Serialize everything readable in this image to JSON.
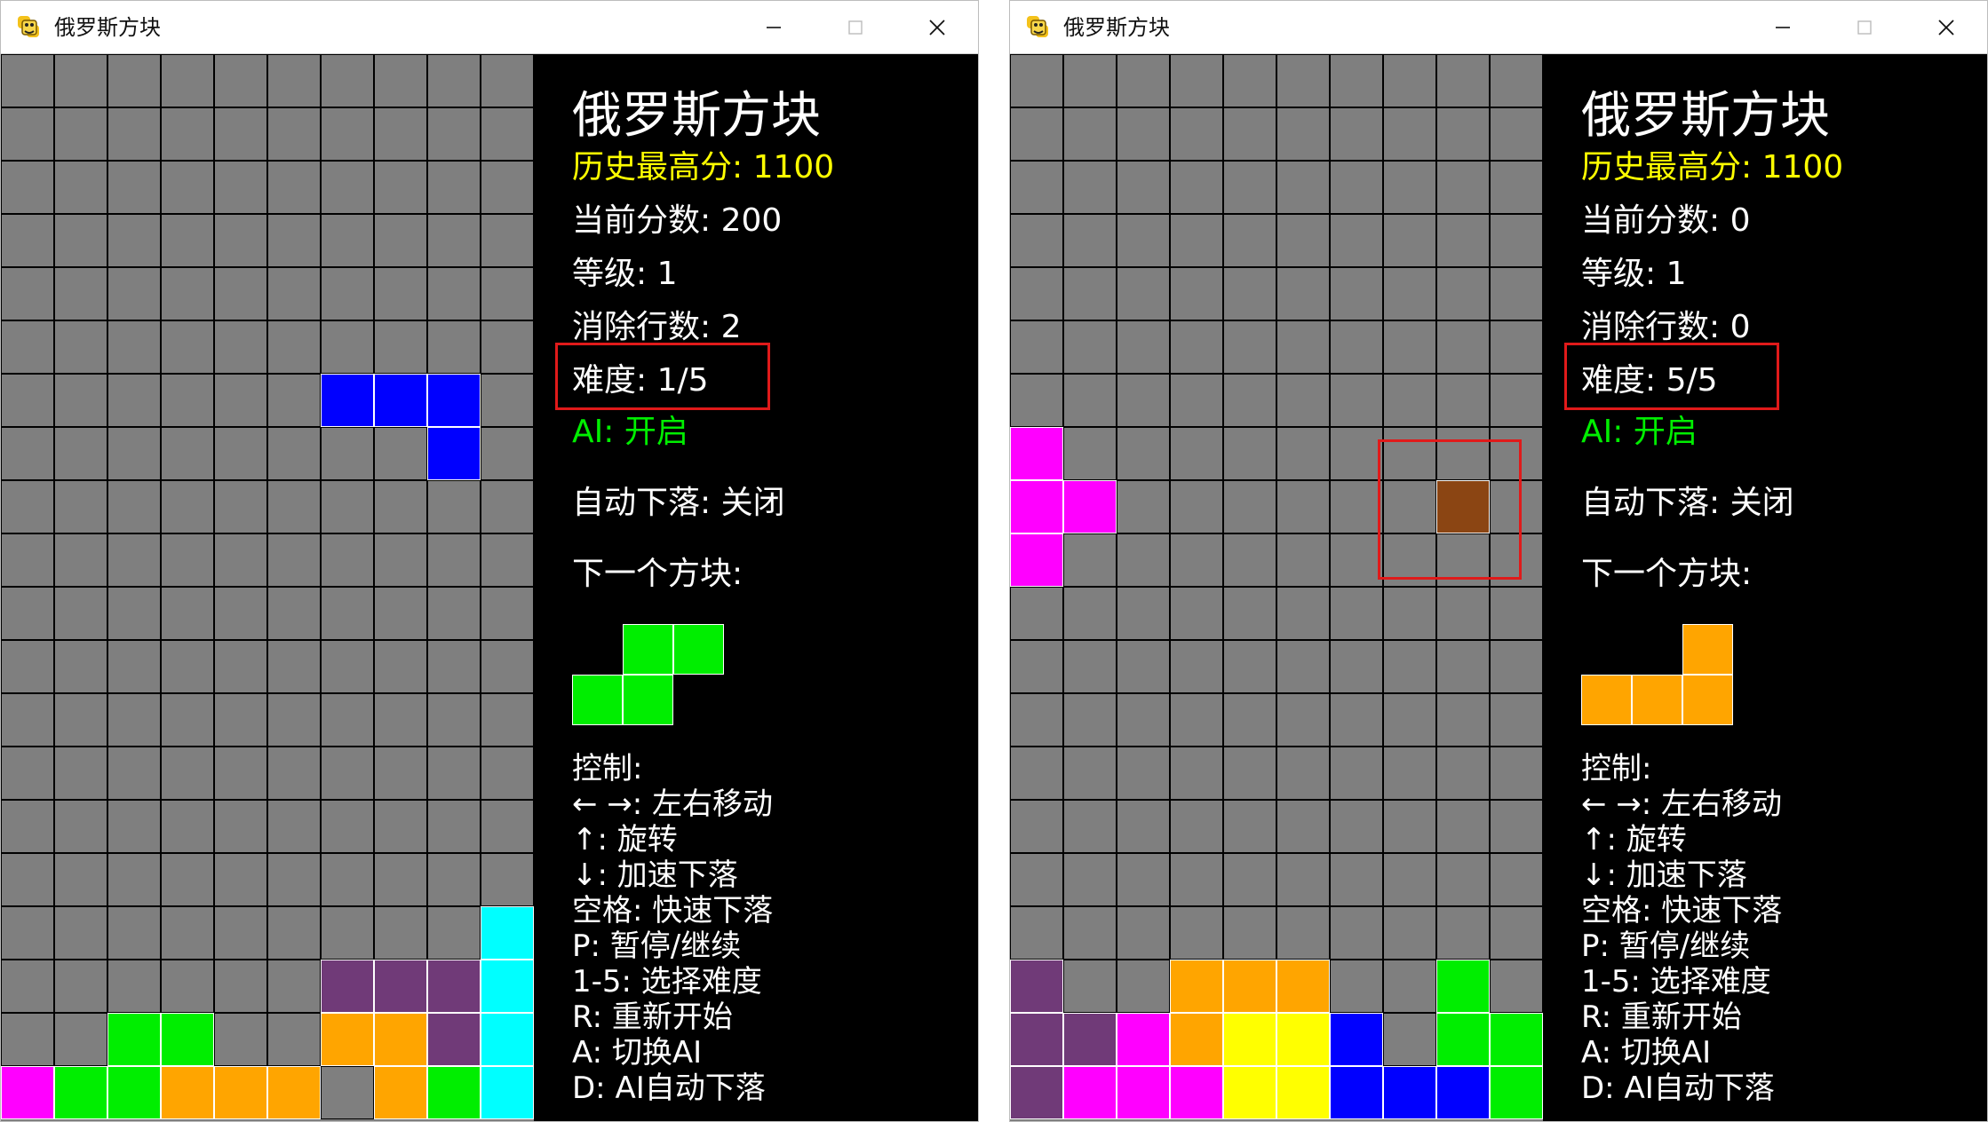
{
  "windows": [
    {
      "title": "俄罗斯方块",
      "panel": {
        "heading": "俄罗斯方块",
        "high_score": "历史最高分: 1100",
        "score": "当前分数: 200",
        "level": "等级: 1",
        "lines": "消除行数: 2",
        "difficulty": "难度: 1/5",
        "ai": "AI: 开启",
        "auto_drop": "自动下落: 关闭",
        "next_label": "下一个方块:",
        "controls": [
          "控制:",
          "← →: 左右移动",
          "↑: 旋转",
          "↓: 加速下落",
          "空格: 快速下落",
          "P: 暂停/继续",
          "1-5: 选择难度",
          "R: 重新开始",
          "A: 切换AI",
          "D: AI自动下落"
        ]
      },
      "next_piece": {
        "color": "#00ee00",
        "cells": [
          [
            1,
            0
          ],
          [
            2,
            0
          ],
          [
            0,
            1
          ],
          [
            1,
            1
          ]
        ]
      },
      "board": {
        "cols": 10,
        "rows": 20,
        "blocks": [
          {
            "col": 6,
            "row": 6,
            "color": "#0000ff"
          },
          {
            "col": 7,
            "row": 6,
            "color": "#0000ff"
          },
          {
            "col": 8,
            "row": 6,
            "color": "#0000ff"
          },
          {
            "col": 8,
            "row": 7,
            "color": "#0000ff"
          },
          {
            "col": 9,
            "row": 16,
            "color": "#00ffff"
          },
          {
            "col": 9,
            "row": 17,
            "color": "#00ffff"
          },
          {
            "col": 9,
            "row": 18,
            "color": "#00ffff"
          },
          {
            "col": 9,
            "row": 19,
            "color": "#00ffff"
          },
          {
            "col": 6,
            "row": 17,
            "color": "#703a78"
          },
          {
            "col": 7,
            "row": 17,
            "color": "#703a78"
          },
          {
            "col": 8,
            "row": 17,
            "color": "#703a78"
          },
          {
            "col": 8,
            "row": 18,
            "color": "#703a78"
          },
          {
            "col": 2,
            "row": 18,
            "color": "#00ee00"
          },
          {
            "col": 3,
            "row": 18,
            "color": "#00ee00"
          },
          {
            "col": 6,
            "row": 18,
            "color": "#ffa500"
          },
          {
            "col": 7,
            "row": 18,
            "color": "#ffa500"
          },
          {
            "col": 0,
            "row": 19,
            "color": "#ff00ff"
          },
          {
            "col": 1,
            "row": 19,
            "color": "#00ee00"
          },
          {
            "col": 2,
            "row": 19,
            "color": "#00ee00"
          },
          {
            "col": 3,
            "row": 19,
            "color": "#ffa500"
          },
          {
            "col": 4,
            "row": 19,
            "color": "#ffa500"
          },
          {
            "col": 5,
            "row": 19,
            "color": "#ffa500"
          },
          {
            "col": 7,
            "row": 19,
            "color": "#ffa500"
          },
          {
            "col": 8,
            "row": 19,
            "color": "#00ee00"
          }
        ]
      }
    },
    {
      "title": "俄罗斯方块",
      "panel": {
        "heading": "俄罗斯方块",
        "high_score": "历史最高分: 1100",
        "score": "当前分数: 0",
        "level": "等级: 1",
        "lines": "消除行数: 0",
        "difficulty": "难度: 5/5",
        "ai": "AI: 开启",
        "auto_drop": "自动下落: 关闭",
        "next_label": "下一个方块:",
        "controls": [
          "控制:",
          "← →: 左右移动",
          "↑: 旋转",
          "↓: 加速下落",
          "空格: 快速下落",
          "P: 暂停/继续",
          "1-5: 选择难度",
          "R: 重新开始",
          "A: 切换AI",
          "D: AI自动下落"
        ]
      },
      "next_piece": {
        "color": "#ffa500",
        "cells": [
          [
            2,
            0
          ],
          [
            0,
            1
          ],
          [
            1,
            1
          ],
          [
            2,
            1
          ]
        ]
      },
      "board": {
        "cols": 10,
        "rows": 20,
        "blocks": [
          {
            "col": 0,
            "row": 7,
            "color": "#ff00ff"
          },
          {
            "col": 0,
            "row": 8,
            "color": "#ff00ff"
          },
          {
            "col": 1,
            "row": 8,
            "color": "#ff00ff"
          },
          {
            "col": 0,
            "row": 9,
            "color": "#ff00ff"
          },
          {
            "col": 8,
            "row": 8,
            "color": "#8b4513"
          },
          {
            "col": 0,
            "row": 17,
            "color": "#703a78"
          },
          {
            "col": 3,
            "row": 17,
            "color": "#ffa500"
          },
          {
            "col": 4,
            "row": 17,
            "color": "#ffa500"
          },
          {
            "col": 5,
            "row": 17,
            "color": "#ffa500"
          },
          {
            "col": 8,
            "row": 17,
            "color": "#00ee00"
          },
          {
            "col": 0,
            "row": 18,
            "color": "#703a78"
          },
          {
            "col": 1,
            "row": 18,
            "color": "#703a78"
          },
          {
            "col": 2,
            "row": 18,
            "color": "#ff00ff"
          },
          {
            "col": 3,
            "row": 18,
            "color": "#ffa500"
          },
          {
            "col": 4,
            "row": 18,
            "color": "#ffff00"
          },
          {
            "col": 5,
            "row": 18,
            "color": "#ffff00"
          },
          {
            "col": 6,
            "row": 18,
            "color": "#0000ff"
          },
          {
            "col": 8,
            "row": 18,
            "color": "#00ee00"
          },
          {
            "col": 9,
            "row": 18,
            "color": "#00ee00"
          },
          {
            "col": 0,
            "row": 19,
            "color": "#703a78"
          },
          {
            "col": 1,
            "row": 19,
            "color": "#ff00ff"
          },
          {
            "col": 2,
            "row": 19,
            "color": "#ff00ff"
          },
          {
            "col": 3,
            "row": 19,
            "color": "#ff00ff"
          },
          {
            "col": 4,
            "row": 19,
            "color": "#ffff00"
          },
          {
            "col": 5,
            "row": 19,
            "color": "#ffff00"
          },
          {
            "col": 6,
            "row": 19,
            "color": "#0000ff"
          },
          {
            "col": 7,
            "row": 19,
            "color": "#0000ff"
          },
          {
            "col": 8,
            "row": 19,
            "color": "#0000ff"
          },
          {
            "col": 9,
            "row": 19,
            "color": "#00ee00"
          }
        ]
      }
    }
  ],
  "colors": {
    "high_score": "#ffff00",
    "ai": "#00ee00",
    "highlight": "#e01a1a",
    "board_bg": "#7f7f7f",
    "panel_bg": "#000000"
  }
}
